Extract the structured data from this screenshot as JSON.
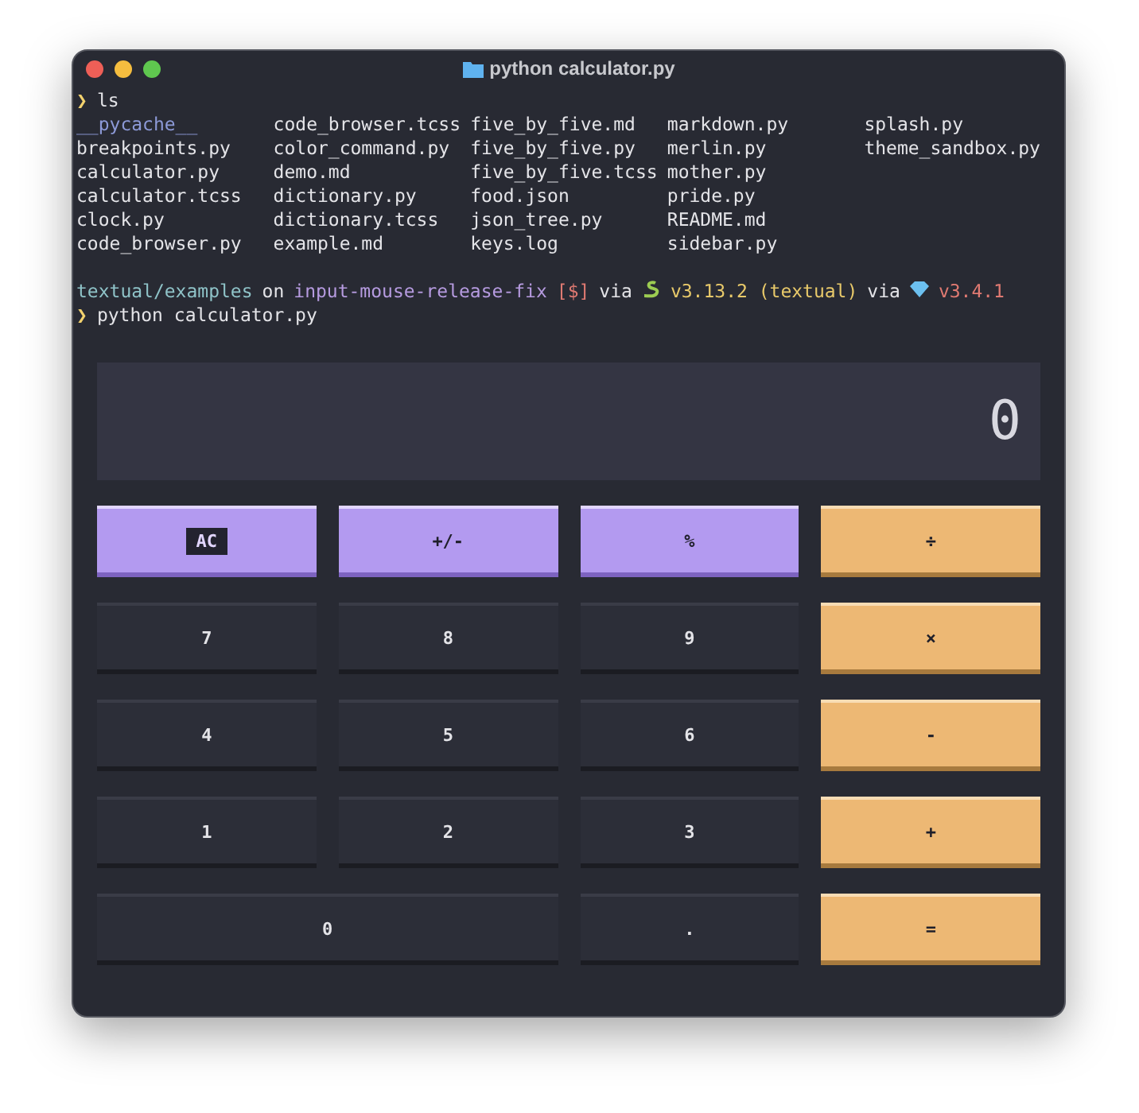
{
  "window": {
    "title": "python calculator.py"
  },
  "terminal": {
    "prompt_symbol": "❯",
    "command": "ls",
    "listing": [
      [
        "__pycache__",
        "breakpoints.py",
        "calculator.py",
        "calculator.tcss",
        "clock.py",
        "code_browser.py"
      ],
      [
        "code_browser.tcss",
        "color_command.py",
        "demo.md",
        "dictionary.py",
        "dictionary.tcss",
        "example.md"
      ],
      [
        "five_by_five.md",
        "five_by_five.py",
        "five_by_five.tcss",
        "food.json",
        "json_tree.py",
        "keys.log"
      ],
      [
        "markdown.py",
        "merlin.py",
        "mother.py",
        "pride.py",
        "README.md",
        "sidebar.py"
      ],
      [
        "splash.py",
        "theme_sandbox.py"
      ]
    ],
    "prompt": {
      "path": "textual/examples",
      "on": "on",
      "branch": "input-mouse-release-fix",
      "status": "[$]",
      "via1": "via",
      "python": "v3.13.2 (textual)",
      "via2": "via",
      "ruby": "v3.4.1"
    },
    "command2": "python calculator.py"
  },
  "calculator": {
    "display": "0",
    "buttons": [
      {
        "label": "AC",
        "kind": "function",
        "focused": true,
        "wide": false
      },
      {
        "label": "+/-",
        "kind": "function",
        "focused": false,
        "wide": false
      },
      {
        "label": "%",
        "kind": "function",
        "focused": false,
        "wide": false
      },
      {
        "label": "÷",
        "kind": "operator",
        "focused": false,
        "wide": false
      },
      {
        "label": "7",
        "kind": "number",
        "focused": false,
        "wide": false
      },
      {
        "label": "8",
        "kind": "number",
        "focused": false,
        "wide": false
      },
      {
        "label": "9",
        "kind": "number",
        "focused": false,
        "wide": false
      },
      {
        "label": "×",
        "kind": "operator",
        "focused": false,
        "wide": false
      },
      {
        "label": "4",
        "kind": "number",
        "focused": false,
        "wide": false
      },
      {
        "label": "5",
        "kind": "number",
        "focused": false,
        "wide": false
      },
      {
        "label": "6",
        "kind": "number",
        "focused": false,
        "wide": false
      },
      {
        "label": "-",
        "kind": "operator",
        "focused": false,
        "wide": false
      },
      {
        "label": "1",
        "kind": "number",
        "focused": false,
        "wide": false
      },
      {
        "label": "2",
        "kind": "number",
        "focused": false,
        "wide": false
      },
      {
        "label": "3",
        "kind": "number",
        "focused": false,
        "wide": false
      },
      {
        "label": "+",
        "kind": "operator",
        "focused": false,
        "wide": false
      },
      {
        "label": "0",
        "kind": "number",
        "focused": false,
        "wide": true
      },
      {
        "label": ".",
        "kind": "number",
        "focused": false,
        "wide": false
      },
      {
        "label": "=",
        "kind": "operator",
        "focused": false,
        "wide": false
      }
    ]
  }
}
